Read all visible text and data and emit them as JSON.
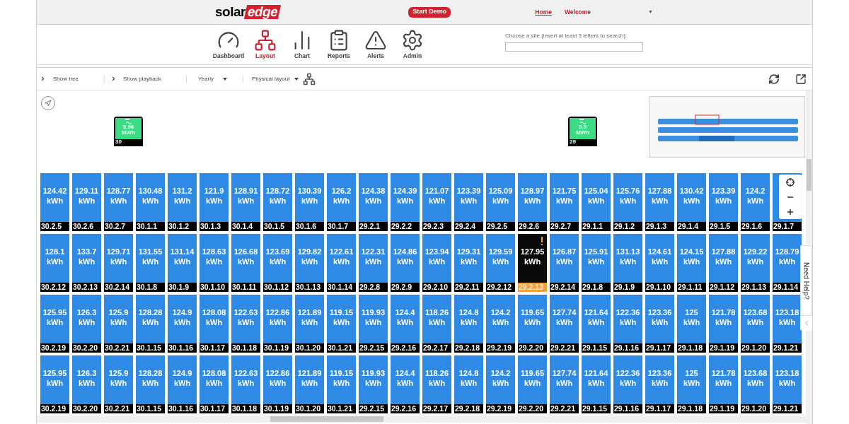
{
  "header": {
    "logo": {
      "dark_part": "solar",
      "accent_part": "edge"
    },
    "demo_button": "Start Demo",
    "home_link": "Home",
    "welcome": "Welcome",
    "caret": "▼"
  },
  "nav": [
    {
      "label": "Dashboard",
      "selected": false
    },
    {
      "label": "Layout",
      "selected": true
    },
    {
      "label": "Chart",
      "selected": false
    },
    {
      "label": "Reports",
      "selected": false
    },
    {
      "label": "Alerts",
      "selected": false
    },
    {
      "label": "Admin",
      "selected": false
    }
  ],
  "site_search": {
    "label": "Choose a site (insert at least 3 letters to search):"
  },
  "toolbar": {
    "show_tree": "Show tree",
    "show_playback": "Show playback",
    "period": "Yearly",
    "layout_mode": "Physical layout"
  },
  "inverters": [
    {
      "value": "5.96",
      "unit": "MWh",
      "id": "30"
    },
    {
      "value": "5.9",
      "unit": "MWh",
      "id": "29"
    }
  ],
  "need_help": "Need Help?",
  "rows": [
    [
      {
        "value": "124.42",
        "unit": "kWh",
        "id": "30.2.5",
        "alert": false
      },
      {
        "value": "129.11",
        "unit": "kWh",
        "id": "30.2.6",
        "alert": false
      },
      {
        "value": "128.77",
        "unit": "kWh",
        "id": "30.2.7",
        "alert": false
      },
      {
        "value": "130.48",
        "unit": "kWh",
        "id": "30.1.1",
        "alert": false
      },
      {
        "value": "131.2",
        "unit": "kWh",
        "id": "30.1.2",
        "alert": false
      },
      {
        "value": "121.9",
        "unit": "kWh",
        "id": "30.1.3",
        "alert": false
      },
      {
        "value": "128.91",
        "unit": "kWh",
        "id": "30.1.4",
        "alert": false
      },
      {
        "value": "128.72",
        "unit": "kWh",
        "id": "30.1.5",
        "alert": false
      },
      {
        "value": "130.39",
        "unit": "kWh",
        "id": "30.1.6",
        "alert": false
      },
      {
        "value": "126.2",
        "unit": "kWh",
        "id": "30.1.7",
        "alert": false
      },
      {
        "value": "124.38",
        "unit": "kWh",
        "id": "29.2.1",
        "alert": false
      },
      {
        "value": "124.39",
        "unit": "kWh",
        "id": "29.2.2",
        "alert": false
      },
      {
        "value": "121.07",
        "unit": "kWh",
        "id": "29.2.3",
        "alert": false
      },
      {
        "value": "123.39",
        "unit": "kWh",
        "id": "29.2.4",
        "alert": false
      },
      {
        "value": "125.09",
        "unit": "kWh",
        "id": "29.2.5",
        "alert": false
      },
      {
        "value": "128.97",
        "unit": "kWh",
        "id": "29.2.6",
        "alert": false
      },
      {
        "value": "121.75",
        "unit": "kWh",
        "id": "29.2.7",
        "alert": false
      },
      {
        "value": "125.04",
        "unit": "kWh",
        "id": "29.1.1",
        "alert": false
      },
      {
        "value": "125.76",
        "unit": "kWh",
        "id": "29.1.2",
        "alert": false
      },
      {
        "value": "127.88",
        "unit": "kWh",
        "id": "29.1.3",
        "alert": false
      },
      {
        "value": "130.42",
        "unit": "kWh",
        "id": "29.1.4",
        "alert": false
      },
      {
        "value": "123.39",
        "unit": "kWh",
        "id": "29.1.5",
        "alert": false
      },
      {
        "value": "124.2",
        "unit": "kWh",
        "id": "29.1.6",
        "alert": false
      },
      {
        "id": "29.1.7",
        "alert": false
      }
    ],
    [
      {
        "value": "128.1",
        "unit": "kWh",
        "id": "30.2.12",
        "alert": false
      },
      {
        "value": "133.7",
        "unit": "kWh",
        "id": "30.2.13",
        "alert": false
      },
      {
        "value": "129.71",
        "unit": "kWh",
        "id": "30.2.14",
        "alert": false
      },
      {
        "value": "131.55",
        "unit": "kWh",
        "id": "30.1.8",
        "alert": false
      },
      {
        "value": "131.14",
        "unit": "kWh",
        "id": "30.1.9",
        "alert": false
      },
      {
        "value": "128.63",
        "unit": "kWh",
        "id": "30.1.10",
        "alert": false
      },
      {
        "value": "126.68",
        "unit": "kWh",
        "id": "30.1.11",
        "alert": false
      },
      {
        "value": "123.69",
        "unit": "kWh",
        "id": "30.1.12",
        "alert": false
      },
      {
        "value": "129.82",
        "unit": "kWh",
        "id": "30.1.13",
        "alert": false
      },
      {
        "value": "122.61",
        "unit": "kWh",
        "id": "30.1.14",
        "alert": false
      },
      {
        "value": "122.31",
        "unit": "kWh",
        "id": "29.2.8",
        "alert": false
      },
      {
        "value": "124.86",
        "unit": "kWh",
        "id": "29.2.9",
        "alert": false
      },
      {
        "value": "123.94",
        "unit": "kWh",
        "id": "29.2.10",
        "alert": false
      },
      {
        "value": "129.31",
        "unit": "kWh",
        "id": "29.2.11",
        "alert": false
      },
      {
        "value": "129.59",
        "unit": "kWh",
        "id": "29.2.12",
        "alert": false
      },
      {
        "value": "127.95",
        "unit": "kWh",
        "id": "29.2.13",
        "alert": true
      },
      {
        "value": "126.87",
        "unit": "kWh",
        "id": "29.2.14",
        "alert": false
      },
      {
        "value": "125.91",
        "unit": "kWh",
        "id": "29.1.8",
        "alert": false
      },
      {
        "value": "131.13",
        "unit": "kWh",
        "id": "29.1.9",
        "alert": false
      },
      {
        "value": "124.61",
        "unit": "kWh",
        "id": "29.1.10",
        "alert": false
      },
      {
        "value": "124.15",
        "unit": "kWh",
        "id": "29.1.11",
        "alert": false
      },
      {
        "value": "127.88",
        "unit": "kWh",
        "id": "29.1.12",
        "alert": false
      },
      {
        "value": "129.22",
        "unit": "kWh",
        "id": "29.1.13",
        "alert": false
      },
      {
        "value": "128.79",
        "unit": "kWh",
        "id": "29.1.14",
        "alert": false
      }
    ],
    [
      {
        "value": "125.95",
        "unit": "kWh",
        "id": "30.2.19",
        "alert": false
      },
      {
        "value": "126.3",
        "unit": "kWh",
        "id": "30.2.20",
        "alert": false
      },
      {
        "value": "125.9",
        "unit": "kWh",
        "id": "30.2.21",
        "alert": false
      },
      {
        "value": "128.28",
        "unit": "kWh",
        "id": "30.1.15",
        "alert": false
      },
      {
        "value": "124.9",
        "unit": "kWh",
        "id": "30.1.16",
        "alert": false
      },
      {
        "value": "128.08",
        "unit": "kWh",
        "id": "30.1.17",
        "alert": false
      },
      {
        "value": "122.63",
        "unit": "kWh",
        "id": "30.1.18",
        "alert": false
      },
      {
        "value": "122.86",
        "unit": "kWh",
        "id": "30.1.19",
        "alert": false
      },
      {
        "value": "121.89",
        "unit": "kWh",
        "id": "30.1.20",
        "alert": false
      },
      {
        "value": "119.15",
        "unit": "kWh",
        "id": "30.1.21",
        "alert": false
      },
      {
        "value": "119.93",
        "unit": "kWh",
        "id": "29.2.15",
        "alert": false
      },
      {
        "value": "124.4",
        "unit": "kWh",
        "id": "29.2.16",
        "alert": false
      },
      {
        "value": "118.26",
        "unit": "kWh",
        "id": "29.2.17",
        "alert": false
      },
      {
        "value": "124.8",
        "unit": "kWh",
        "id": "29.2.18",
        "alert": false
      },
      {
        "value": "124.2",
        "unit": "kWh",
        "id": "29.2.19",
        "alert": false
      },
      {
        "value": "119.65",
        "unit": "kWh",
        "id": "29.2.20",
        "alert": false
      },
      {
        "value": "127.74",
        "unit": "kWh",
        "id": "29.2.21",
        "alert": false
      },
      {
        "value": "121.64",
        "unit": "kWh",
        "id": "29.1.15",
        "alert": false
      },
      {
        "value": "122.36",
        "unit": "kWh",
        "id": "29.1.16",
        "alert": false
      },
      {
        "value": "123.36",
        "unit": "kWh",
        "id": "29.1.17",
        "alert": false
      },
      {
        "value": "125",
        "unit": "kWh",
        "id": "29.1.18",
        "alert": false
      },
      {
        "value": "121.78",
        "unit": "kWh",
        "id": "29.1.19",
        "alert": false
      },
      {
        "value": "123.68",
        "unit": "kWh",
        "id": "29.1.20",
        "alert": false
      },
      {
        "value": "123.18",
        "unit": "kWh",
        "id": "29.1.21",
        "alert": false
      }
    ],
    [
      {
        "value": "125.95",
        "unit": "kWh",
        "id": "30.2.19",
        "alert": false
      },
      {
        "value": "126.3",
        "unit": "kWh",
        "id": "30.2.20",
        "alert": false
      },
      {
        "value": "125.9",
        "unit": "kWh",
        "id": "30.2.21",
        "alert": false
      },
      {
        "value": "128.28",
        "unit": "kWh",
        "id": "30.1.15",
        "alert": false
      },
      {
        "value": "124.9",
        "unit": "kWh",
        "id": "30.1.16",
        "alert": false
      },
      {
        "value": "128.08",
        "unit": "kWh",
        "id": "30.1.17",
        "alert": false
      },
      {
        "value": "122.63",
        "unit": "kWh",
        "id": "30.1.18",
        "alert": false
      },
      {
        "value": "122.86",
        "unit": "kWh",
        "id": "30.1.19",
        "alert": false
      },
      {
        "value": "121.89",
        "unit": "kWh",
        "id": "30.1.20",
        "alert": false
      },
      {
        "value": "119.15",
        "unit": "kWh",
        "id": "30.1.21",
        "alert": false
      },
      {
        "value": "119.93",
        "unit": "kWh",
        "id": "29.2.15",
        "alert": false
      },
      {
        "value": "124.4",
        "unit": "kWh",
        "id": "29.2.16",
        "alert": false
      },
      {
        "value": "118.26",
        "unit": "kWh",
        "id": "29.2.17",
        "alert": false
      },
      {
        "value": "124.8",
        "unit": "kWh",
        "id": "29.2.18",
        "alert": false
      },
      {
        "value": "124.2",
        "unit": "kWh",
        "id": "29.2.19",
        "alert": false
      },
      {
        "value": "119.65",
        "unit": "kWh",
        "id": "29.2.20",
        "alert": false
      },
      {
        "value": "127.74",
        "unit": "kWh",
        "id": "29.2.21",
        "alert": false
      },
      {
        "value": "121.64",
        "unit": "kWh",
        "id": "29.1.15",
        "alert": false
      },
      {
        "value": "122.36",
        "unit": "kWh",
        "id": "29.1.16",
        "alert": false
      },
      {
        "value": "123.36",
        "unit": "kWh",
        "id": "29.1.17",
        "alert": false
      },
      {
        "value": "125",
        "unit": "kWh",
        "id": "29.1.18",
        "alert": false
      },
      {
        "value": "121.78",
        "unit": "kWh",
        "id": "29.1.19",
        "alert": false
      },
      {
        "value": "123.68",
        "unit": "kWh",
        "id": "29.1.20",
        "alert": false
      },
      {
        "value": "123.18",
        "unit": "kWh",
        "id": "29.1.21",
        "alert": false
      }
    ]
  ]
}
